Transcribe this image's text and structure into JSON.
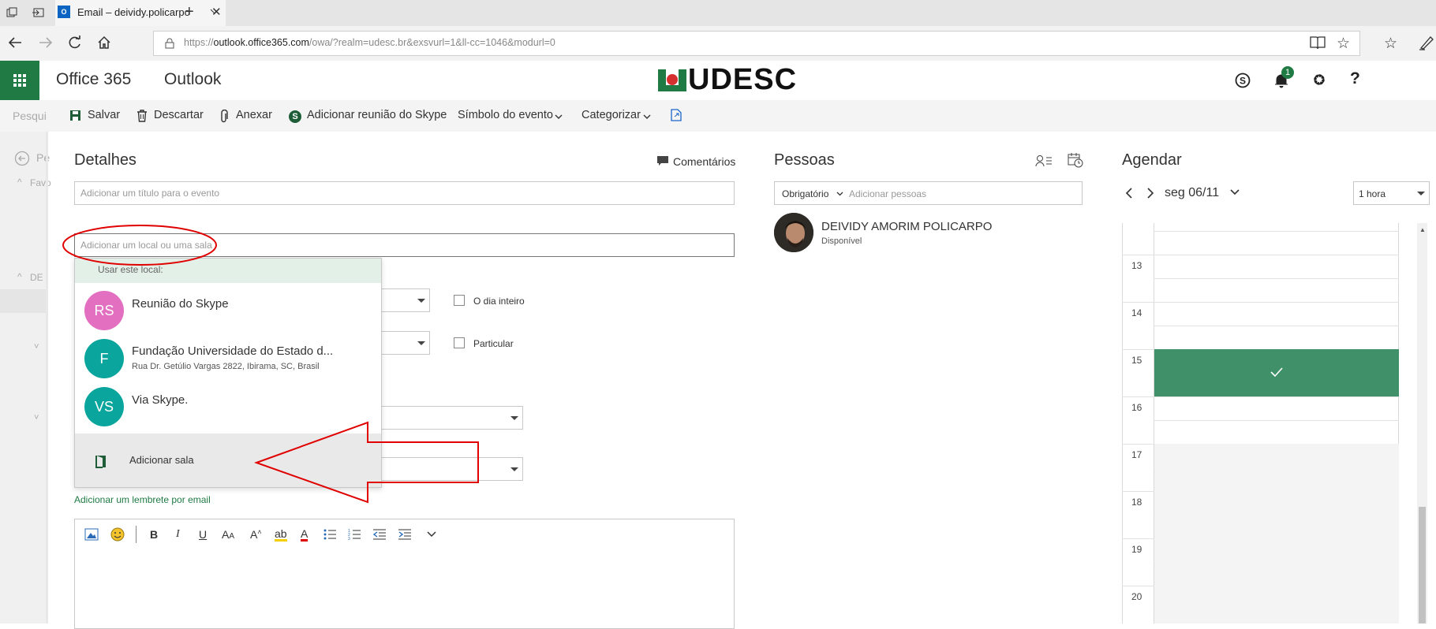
{
  "browser": {
    "tab_title": "Email – deividy.policarpo",
    "url_prefix": "https://",
    "url_domain": "outlook.office365.com",
    "url_path": "/owa/?realm=udesc.br&exsvurl=1&ll-cc=1046&modurl=0"
  },
  "header": {
    "suite_name": "Office 365",
    "app_name": "Outlook",
    "logo_text": "UDESC",
    "notification_count": "1"
  },
  "toolbar": {
    "save": "Salvar",
    "discard": "Descartar",
    "attach": "Anexar",
    "skype_meeting": "Adicionar reunião do Skype",
    "event_symbol": "Símbolo do evento",
    "categorize": "Categorizar"
  },
  "left_nav": {
    "search_placeholder": "Pesqui",
    "back_label": "Pe",
    "favorites_label": "Favo",
    "group_label": "DE"
  },
  "details": {
    "heading": "Detalhes",
    "comments": "Comentários",
    "title_placeholder": "Adicionar um título para o evento",
    "location_placeholder": "Adicionar um local ou uma sala",
    "all_day": "O dia inteiro",
    "private": "Particular",
    "email_reminder": "Adicionar um lembrete por email"
  },
  "location_dropdown": {
    "header": "Usar este local:",
    "items": [
      {
        "initials": "RS",
        "name": "Reunião do Skype",
        "sub": "",
        "color": "#e26fc0"
      },
      {
        "initials": "F",
        "name": "Fundação Universidade do Estado d...",
        "sub": "Rua Dr. Getúlio Vargas 2822, Ibirama, SC, Brasil",
        "color": "#0aa59c"
      },
      {
        "initials": "VS",
        "name": "Via Skype.",
        "sub": "",
        "color": "#0aa59c"
      }
    ],
    "add_room": "Adicionar sala"
  },
  "people": {
    "heading": "Pessoas",
    "required_label": "Obrigatório",
    "add_people_placeholder": "Adicionar pessoas",
    "attendee_name": "DEIVIDY AMORIM POLICARPO",
    "attendee_status": "Disponível"
  },
  "schedule": {
    "heading": "Agendar",
    "date": "seg 06/11",
    "duration": "1 hora",
    "hours": [
      "13",
      "14",
      "15",
      "16",
      "17",
      "18",
      "19",
      "20"
    ]
  },
  "colors": {
    "brand_green": "#1f7a44",
    "event_green": "#40916a",
    "annotation_red": "#e00000"
  }
}
